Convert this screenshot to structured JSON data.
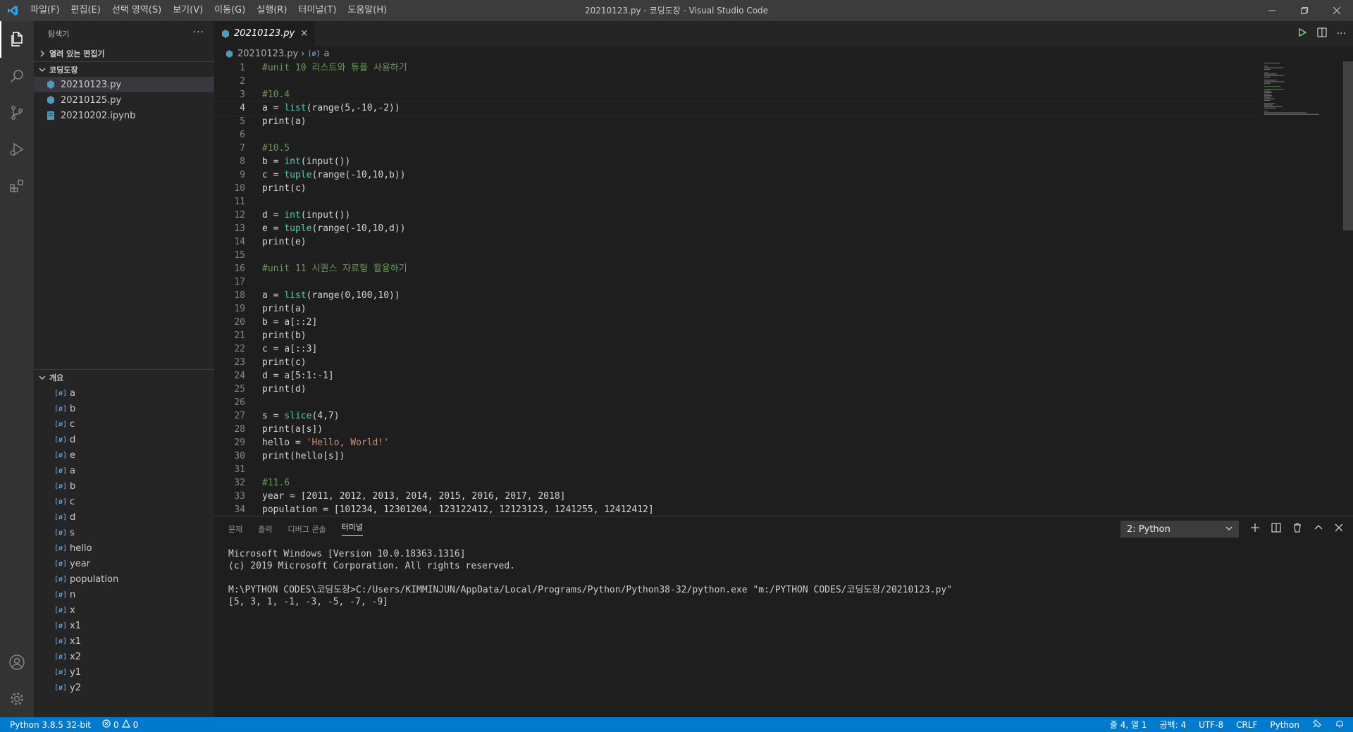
{
  "window": {
    "title": "20210123.py - 코딩도장 - Visual Studio Code",
    "menu": [
      "파일(F)",
      "편집(E)",
      "선택 영역(S)",
      "보기(V)",
      "이동(G)",
      "실행(R)",
      "터미널(T)",
      "도움말(H)"
    ]
  },
  "sidebar": {
    "header": "탐색기",
    "more": "···",
    "open_editors": "열려 있는 편집기",
    "folder": "코딩도장",
    "files": [
      {
        "name": "20210123.py",
        "icon": "python-file-icon"
      },
      {
        "name": "20210125.py",
        "icon": "python-file-icon"
      },
      {
        "name": "20210202.ipynb",
        "icon": "notebook-file-icon"
      }
    ],
    "outline_title": "개요",
    "outline": [
      "a",
      "b",
      "c",
      "d",
      "e",
      "a",
      "b",
      "c",
      "d",
      "s",
      "hello",
      "year",
      "population",
      "n",
      "x",
      "x1",
      "x1",
      "x2",
      "y1",
      "y2"
    ]
  },
  "editor": {
    "tab_label": "20210123.py",
    "tab_close": "×",
    "breadcrumb": {
      "file": "20210123.py",
      "symbol": "a"
    },
    "current_line": 4,
    "lines": [
      "#unit 10 리스트와 튜플 사용하기",
      "",
      "#10.4",
      "a = list(range(5,-10,-2))",
      "print(a)",
      "",
      "#10.5",
      "b = int(input())",
      "c = tuple(range(-10,10,b))",
      "print(c)",
      "",
      "d = int(input())",
      "e = tuple(range(-10,10,d))",
      "print(e)",
      "",
      "#unit 11 시퀀스 자료형 활용하기",
      "",
      "a = list(range(0,100,10))",
      "print(a)",
      "b = a[::2]",
      "print(b)",
      "c = a[::3]",
      "print(c)",
      "d = a[5:1:-1]",
      "print(d)",
      "",
      "s = slice(4,7)",
      "print(a[s])",
      "hello = 'Hello, World!'",
      "print(hello[s])",
      "",
      "#11.6",
      "year = [2011, 2012, 2013, 2014, 2015, 2016, 2017, 2018]",
      "population = [101234, 12301204, 123122412, 12123123, 1241255, 12412412]"
    ]
  },
  "panel": {
    "tabs": [
      "문제",
      "출력",
      "디버그 콘솔",
      "터미널"
    ],
    "active_tab": "터미널",
    "terminal_select": "2: Python",
    "terminal_lines": [
      "Microsoft Windows [Version 10.0.18363.1316]",
      "(c) 2019 Microsoft Corporation. All rights reserved.",
      "",
      "M:\\PYTHON CODES\\코딩도장>C:/Users/KIMMINJUN/AppData/Local/Programs/Python/Python38-32/python.exe \"m:/PYTHON CODES/코딩도장/20210123.py\"",
      "[5, 3, 1, -1, -3, -5, -7, -9]"
    ]
  },
  "statusbar": {
    "interpreter": "Python 3.8.5 32-bit",
    "errors": "0",
    "warnings": "0",
    "position": "줄 4, 열 1",
    "spaces": "공백: 4",
    "encoding": "UTF-8",
    "eol": "CRLF",
    "language": "Python"
  },
  "colors": {
    "accent": "#007acc",
    "comment": "#6a9955",
    "builtin": "#4ec9b0",
    "string": "#ce9178",
    "python_icon": "#519aba"
  }
}
